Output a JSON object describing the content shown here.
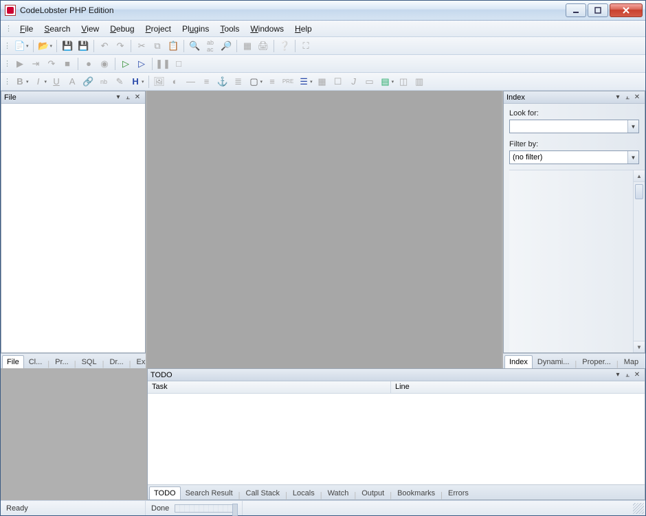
{
  "title": "CodeLobster PHP Edition",
  "menu": {
    "file": "File",
    "search": "Search",
    "view": "View",
    "debug": "Debug",
    "project": "Project",
    "plugins": "Plugins",
    "tools": "Tools",
    "windows": "Windows",
    "help": "Help"
  },
  "panels": {
    "file": {
      "title": "File"
    },
    "index": {
      "title": "Index",
      "lookfor_label": "Look for:",
      "lookfor_value": "",
      "filterby_label": "Filter by:",
      "filterby_value": "(no filter)",
      "tabs": [
        "Index",
        "Dynami...",
        "Proper...",
        "Map"
      ]
    },
    "todo": {
      "title": "TODO",
      "col_task": "Task",
      "col_line": "Line",
      "tabs": [
        "TODO",
        "Search Result",
        "Call Stack",
        "Locals",
        "Watch",
        "Output",
        "Bookmarks",
        "Errors"
      ]
    }
  },
  "left_tabs": [
    "File",
    "Cl...",
    "Pr...",
    "SQL",
    "Dr...",
    "Ex..."
  ],
  "status": {
    "ready": "Ready",
    "done": "Done"
  },
  "icons": {
    "min": "–",
    "close": "✕",
    "dropdown": "▾",
    "pin": "📌",
    "x": "✕",
    "up": "▲",
    "down": "▼"
  }
}
